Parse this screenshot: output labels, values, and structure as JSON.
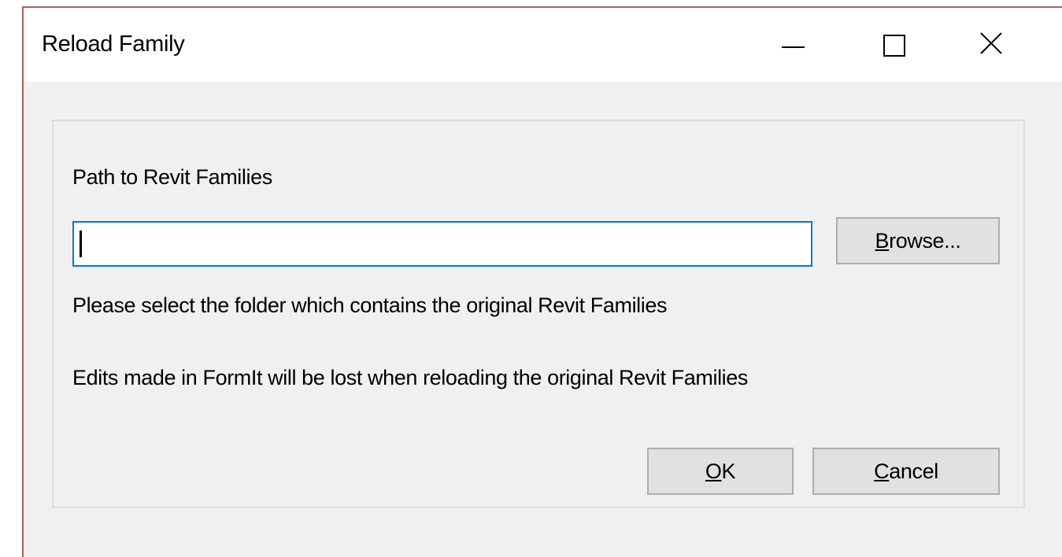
{
  "window": {
    "title": "Reload Family",
    "controls": {
      "minimize": "minimize-icon",
      "maximize": "maximize-icon",
      "close": "close-icon"
    }
  },
  "form": {
    "path_label": "Path to Revit Families",
    "path_input": {
      "value": "",
      "placeholder": ""
    },
    "browse_button": {
      "accel": "B",
      "rest": "rowse..."
    },
    "hint": "Please select the folder which contains the original Revit Families",
    "warning": "Edits made in FormIt will be lost when reloading the original Revit Families"
  },
  "buttons": {
    "ok": {
      "accel": "O",
      "rest": "K"
    },
    "cancel": {
      "accel": "C",
      "rest": "ancel"
    }
  },
  "colors": {
    "window_border": "#b85a5a",
    "input_focus_border": "#0078d7",
    "dialog_background": "#f0f0f0",
    "button_face": "#e1e1e1"
  }
}
